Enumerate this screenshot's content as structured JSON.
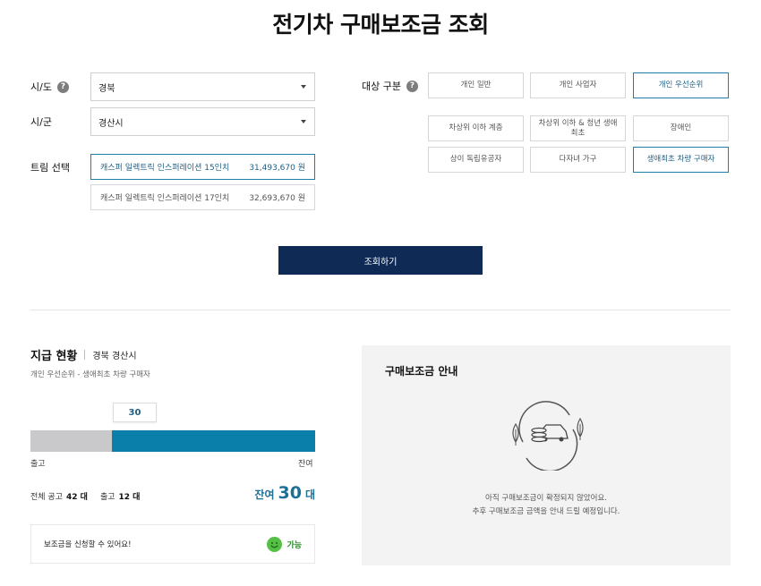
{
  "page": {
    "title": "전기차 구매보조금 조회"
  },
  "filters": {
    "region_label": "시/도",
    "region_value": "경북",
    "city_label": "시/군",
    "city_value": "경산시",
    "trim_label": "트림 선택",
    "trims": [
      {
        "name": "캐스퍼 일렉트릭 인스퍼레이션 15인치",
        "price": "31,493,670 원"
      },
      {
        "name": "캐스퍼 일렉트릭 인스퍼레이션 17인치",
        "price": "32,693,670 원"
      }
    ],
    "selected_trim": 0,
    "target_label": "대상 구분",
    "targets": [
      "개인 일반",
      "개인 사업자",
      "개인 우선순위",
      "차상위 이하 계층",
      "차상위 이하 & 청년 생애 최초",
      "장애인",
      "상이 독립유공자",
      "다자녀 가구",
      "생애최초 차량 구매자"
    ],
    "selected_targets": [
      "개인 우선순위",
      "생애최초 차량 구매자"
    ],
    "help_icon": "?"
  },
  "search_button": "조회하기",
  "status": {
    "title": "지급 현황",
    "location": "경북 경산시",
    "subtitle": "개인 우선순위 - 생애최초 차량 구매자",
    "bubble_value": "30",
    "released_label": "출고",
    "remaining_label": "잔여",
    "remaining_fraction": 0.714,
    "total_label": "전체 공고",
    "total_value": "42 대",
    "released_value_label": "출고",
    "released_value": "12 대",
    "remain_prefix": "잔여",
    "remain_number": "30",
    "remain_unit": "대",
    "notice_text": "보조금을 신청할 수 있어요!",
    "notice_status": "가능"
  },
  "info": {
    "title": "구매보조금 안내",
    "message_line1": "아직 구매보조금이 확정되지 않았어요.",
    "message_line2": "추후 구매보조금 금액을 안내 드릴 예정입니다."
  },
  "colors": {
    "primary": "#0f2a55",
    "accent": "#0a7fa9",
    "bar_bg": "#c9c9cb",
    "ok_green": "#55c144"
  }
}
